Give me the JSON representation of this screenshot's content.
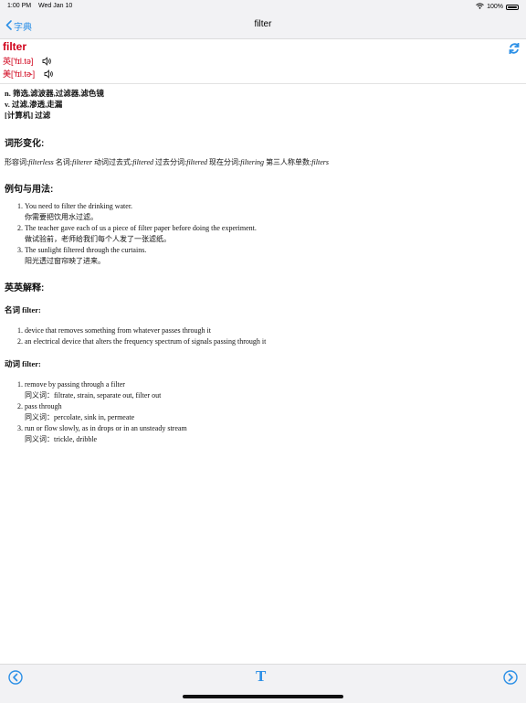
{
  "statusbar": {
    "time": "1:00 PM",
    "date": "Wed Jan 10",
    "battery": "100%"
  },
  "nav": {
    "back_label": "字典",
    "title": "filter"
  },
  "entry": {
    "word": "filter",
    "uk_phonetic": "英['fɪl.tə]",
    "us_phonetic": "美['fɪl.tɚ]"
  },
  "definitions": [
    "n. 筛选,滤波器,过滤器,滤色镜",
    "v. 过滤,渗透,走漏",
    "[计算机] 过滤"
  ],
  "morph": {
    "heading": "词形变化:",
    "items": [
      {
        "label": "形容词:",
        "form": "filterless"
      },
      {
        "label": "名词:",
        "form": "filterer"
      },
      {
        "label": "动词过去式:",
        "form": "filtered"
      },
      {
        "label": "过去分词:",
        "form": "filtered"
      },
      {
        "label": "现在分词:",
        "form": "filtering"
      },
      {
        "label": "第三人称单数:",
        "form": "filters"
      }
    ]
  },
  "examples": {
    "heading": "例句与用法:",
    "items": [
      {
        "en": "You need to filter the drinking water.",
        "zh": "你需要把饮用水过滤。"
      },
      {
        "en": "The teacher gave each of us a piece of filter paper before doing the experiment.",
        "zh": "做试验前，老师给我们每个人发了一张滤纸。"
      },
      {
        "en": "The sunlight filtered through the curtains.",
        "zh": "阳光透过窗帘映了进来。"
      }
    ]
  },
  "english": {
    "heading": "英英解释:",
    "noun_heading": "名词 filter:",
    "noun_items": [
      "device that removes something from whatever passes through it",
      "an electrical device that alters the frequency spectrum of signals passing through it"
    ],
    "verb_heading": "动词 filter:",
    "verb_items": [
      {
        "def": "remove by passing through a filter",
        "syn": "同义词：filtrate, strain, separate out, filter out"
      },
      {
        "def": "pass through",
        "syn": "同义词：percolate, sink in, permeate"
      },
      {
        "def": "run or flow slowly, as in drops or in an unsteady stream",
        "syn": "同义词：trickle, dribble"
      }
    ]
  },
  "toolbar": {
    "font_label": "T"
  },
  "colors": {
    "accent": "#2b8fe6",
    "headword": "#d0021b"
  }
}
